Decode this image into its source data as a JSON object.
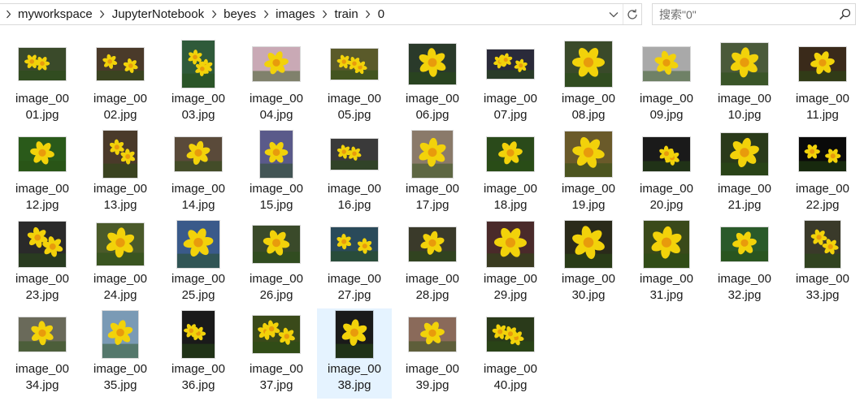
{
  "breadcrumb": {
    "items": [
      "myworkspace",
      "JupyterNotebook",
      "beyes",
      "images",
      "train",
      "0"
    ]
  },
  "search": {
    "placeholder": "搜索\"0\""
  },
  "icons": {
    "breadcrumb_separator": "chevron-right-icon",
    "history": "chevron-down-icon",
    "refresh": "refresh-icon",
    "search": "search-icon"
  },
  "colors": {
    "selection": "#e5f3ff",
    "accent": "#0078d7",
    "flower_yellow": "#f2d20a",
    "flower_center": "#e89b0c"
  },
  "files": [
    {
      "line1": "image_00",
      "line2": "01.jpg",
      "thumb": {
        "w": 58,
        "h": 40,
        "bg": "#3a4a2a",
        "flowers": 2
      }
    },
    {
      "line1": "image_00",
      "line2": "02.jpg",
      "thumb": {
        "w": 58,
        "h": 40,
        "bg": "#4a3a2a",
        "flowers": 2
      }
    },
    {
      "line1": "image_00",
      "line2": "03.jpg",
      "thumb": {
        "w": 40,
        "h": 58,
        "bg": "#2f5a3a",
        "flowers": 3
      }
    },
    {
      "line1": "image_00",
      "line2": "04.jpg",
      "thumb": {
        "w": 58,
        "h": 42,
        "bg": "#c9a9b5",
        "flowers": 1
      }
    },
    {
      "line1": "image_00",
      "line2": "05.jpg",
      "thumb": {
        "w": 58,
        "h": 38,
        "bg": "#5a5a2a",
        "flowers": 3
      }
    },
    {
      "line1": "image_00",
      "line2": "06.jpg",
      "thumb": {
        "w": 58,
        "h": 50,
        "bg": "#2a3a2a",
        "flowers": 1
      }
    },
    {
      "line1": "image_00",
      "line2": "07.jpg",
      "thumb": {
        "w": 58,
        "h": 36,
        "bg": "#2a2a3a",
        "flowers": 3
      }
    },
    {
      "line1": "image_00",
      "line2": "08.jpg",
      "thumb": {
        "w": 58,
        "h": 56,
        "bg": "#3a4a2a",
        "flowers": 1
      }
    },
    {
      "line1": "image_00",
      "line2": "09.jpg",
      "thumb": {
        "w": 58,
        "h": 42,
        "bg": "#a9a9a9",
        "flowers": 1
      }
    },
    {
      "line1": "image_00",
      "line2": "10.jpg",
      "thumb": {
        "w": 58,
        "h": 52,
        "bg": "#4a5a3a",
        "flowers": 1
      }
    },
    {
      "line1": "image_00",
      "line2": "11.jpg",
      "thumb": {
        "w": 58,
        "h": 42,
        "bg": "#3a2a1a",
        "flowers": 1
      }
    },
    {
      "line1": "image_00",
      "line2": "12.jpg",
      "thumb": {
        "w": 58,
        "h": 42,
        "bg": "#2a5a1a",
        "flowers": 1
      }
    },
    {
      "line1": "image_00",
      "line2": "13.jpg",
      "thumb": {
        "w": 42,
        "h": 58,
        "bg": "#4a3a2a",
        "flowers": 2
      }
    },
    {
      "line1": "image_00",
      "line2": "14.jpg",
      "thumb": {
        "w": 58,
        "h": 42,
        "bg": "#5a4a3a",
        "flowers": 1
      }
    },
    {
      "line1": "image_00",
      "line2": "15.jpg",
      "thumb": {
        "w": 40,
        "h": 58,
        "bg": "#5a5a8a",
        "flowers": 1
      }
    },
    {
      "line1": "image_00",
      "line2": "16.jpg",
      "thumb": {
        "w": 58,
        "h": 38,
        "bg": "#3a3a3a",
        "flowers": 2
      }
    },
    {
      "line1": "image_00",
      "line2": "17.jpg",
      "thumb": {
        "w": 50,
        "h": 58,
        "bg": "#8a7a6a",
        "flowers": 1
      }
    },
    {
      "line1": "image_00",
      "line2": "18.jpg",
      "thumb": {
        "w": 58,
        "h": 42,
        "bg": "#2a4a1a",
        "flowers": 1
      }
    },
    {
      "line1": "image_00",
      "line2": "19.jpg",
      "thumb": {
        "w": 58,
        "h": 56,
        "bg": "#6a5a2a",
        "flowers": 1
      }
    },
    {
      "line1": "image_00",
      "line2": "20.jpg",
      "thumb": {
        "w": 58,
        "h": 42,
        "bg": "#1a1a1a",
        "flowers": 2
      }
    },
    {
      "line1": "image_00",
      "line2": "21.jpg",
      "thumb": {
        "w": 58,
        "h": 52,
        "bg": "#2a3a1a",
        "flowers": 1
      }
    },
    {
      "line1": "image_00",
      "line2": "22.jpg",
      "thumb": {
        "w": 58,
        "h": 42,
        "bg": "#0a0a0a",
        "flowers": 2
      }
    },
    {
      "line1": "image_00",
      "line2": "23.jpg",
      "thumb": {
        "w": 58,
        "h": 56,
        "bg": "#2a2a2a",
        "flowers": 2
      }
    },
    {
      "line1": "image_00",
      "line2": "24.jpg",
      "thumb": {
        "w": 58,
        "h": 52,
        "bg": "#4a5a2a",
        "flowers": 1
      }
    },
    {
      "line1": "image_00",
      "line2": "25.jpg",
      "thumb": {
        "w": 52,
        "h": 58,
        "bg": "#3a5a8a",
        "flowers": 1
      }
    },
    {
      "line1": "image_00",
      "line2": "26.jpg",
      "thumb": {
        "w": 58,
        "h": 46,
        "bg": "#3a4a2a",
        "flowers": 1
      }
    },
    {
      "line1": "image_00",
      "line2": "27.jpg",
      "thumb": {
        "w": 58,
        "h": 42,
        "bg": "#2a4a5a",
        "flowers": 2
      }
    },
    {
      "line1": "image_00",
      "line2": "28.jpg",
      "thumb": {
        "w": 58,
        "h": 42,
        "bg": "#3a3a2a",
        "flowers": 1
      }
    },
    {
      "line1": "image_00",
      "line2": "29.jpg",
      "thumb": {
        "w": 58,
        "h": 56,
        "bg": "#4a2a2a",
        "flowers": 1
      }
    },
    {
      "line1": "image_00",
      "line2": "30.jpg",
      "thumb": {
        "w": 58,
        "h": 58,
        "bg": "#2a2a1a",
        "flowers": 1
      }
    },
    {
      "line1": "image_00",
      "line2": "31.jpg",
      "thumb": {
        "w": 56,
        "h": 58,
        "bg": "#3a4a1a",
        "flowers": 1
      }
    },
    {
      "line1": "image_00",
      "line2": "32.jpg",
      "thumb": {
        "w": 58,
        "h": 42,
        "bg": "#2a5a2a",
        "flowers": 1
      }
    },
    {
      "line1": "image_00",
      "line2": "33.jpg",
      "thumb": {
        "w": 44,
        "h": 58,
        "bg": "#3a3a2a",
        "flowers": 2
      }
    },
    {
      "line1": "image_00",
      "line2": "34.jpg",
      "thumb": {
        "w": 58,
        "h": 42,
        "bg": "#6a6a5a",
        "flowers": 1
      }
    },
    {
      "line1": "image_00",
      "line2": "35.jpg",
      "thumb": {
        "w": 44,
        "h": 58,
        "bg": "#7a9ab5",
        "flowers": 1
      }
    },
    {
      "line1": "image_00",
      "line2": "36.jpg",
      "thumb": {
        "w": 40,
        "h": 58,
        "bg": "#1a1a1a",
        "flowers": 2
      }
    },
    {
      "line1": "image_00",
      "line2": "37.jpg",
      "thumb": {
        "w": 58,
        "h": 46,
        "bg": "#3a4a1a",
        "flowers": 3
      }
    },
    {
      "line1": "image_00",
      "line2": "38.jpg",
      "thumb": {
        "w": 46,
        "h": 58,
        "bg": "#1a1a1a",
        "flowers": 1
      },
      "selected": true
    },
    {
      "line1": "image_00",
      "line2": "39.jpg",
      "thumb": {
        "w": 58,
        "h": 42,
        "bg": "#8a6a5a",
        "flowers": 1
      }
    },
    {
      "line1": "image_00",
      "line2": "40.jpg",
      "thumb": {
        "w": 58,
        "h": 42,
        "bg": "#2a3a1a",
        "flowers": 3
      }
    }
  ]
}
